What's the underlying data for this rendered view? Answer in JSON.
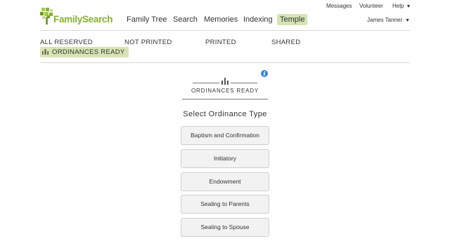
{
  "utility_nav": {
    "messages": "Messages",
    "volunteer": "Volunteer",
    "help": "Help",
    "caret": "▼"
  },
  "logo": {
    "text": "FamilySearch"
  },
  "main_nav": {
    "items": [
      {
        "label": "Family Tree"
      },
      {
        "label": "Search"
      },
      {
        "label": "Memories"
      },
      {
        "label": "Indexing"
      },
      {
        "label": "Temple",
        "active": true
      }
    ]
  },
  "user": {
    "name": "James Tanner",
    "caret": "▼"
  },
  "status_tabs": {
    "items": [
      {
        "label": "ALL RESERVED",
        "active": true
      },
      {
        "label": "NOT PRINTED"
      },
      {
        "label": "PRINTED"
      },
      {
        "label": "SHARED"
      }
    ],
    "sub_active": {
      "label": "ORDINANCES READY",
      "icon": "temple-icon"
    }
  },
  "info": {
    "glyph": "i",
    "icon": "info-icon"
  },
  "panel": {
    "heading": "ORDINANCES READY",
    "heading_icon": "temple-icon",
    "select_title": "Select Ordinance Type",
    "buttons": [
      {
        "label": "Baptism and Confirmation"
      },
      {
        "label": "Initiatory"
      },
      {
        "label": "Endowment"
      },
      {
        "label": "Sealing to Parents"
      },
      {
        "label": "Sealing to Spouse"
      }
    ]
  },
  "colors": {
    "brand_green": "#87b232",
    "active_bg": "#d6e4b4",
    "info_blue": "#3a87d6",
    "button_bg": "#f2f2f2"
  }
}
